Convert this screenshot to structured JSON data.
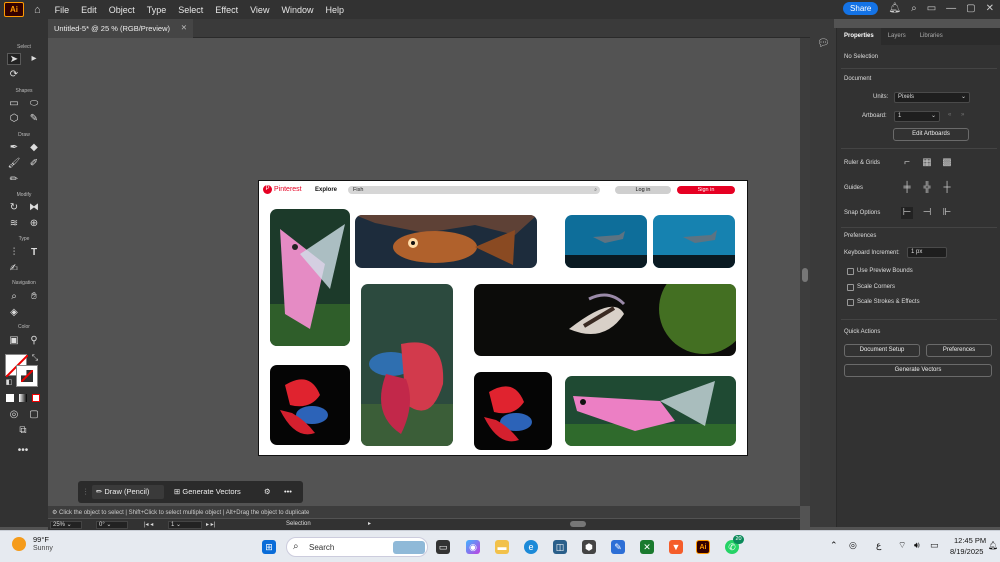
{
  "menubar": {
    "app_logo": "Ai",
    "items": [
      "File",
      "Edit",
      "Object",
      "Type",
      "Select",
      "Effect",
      "View",
      "Window",
      "Help"
    ],
    "share_label": "Share"
  },
  "document_tab": {
    "title": "Untitled-5* @ 25 % (RGB/Preview)"
  },
  "toolbar": {
    "sections": [
      "Select",
      "Shapes",
      "Draw",
      "Modify",
      "Type",
      "Navigation",
      "Color"
    ]
  },
  "artboard": {
    "brand": "Pinterest",
    "explore": "Explore",
    "search_value": "Fish",
    "login": "Log in",
    "signin": "Sign in"
  },
  "properties": {
    "tabs": [
      "Properties",
      "Layers",
      "Libraries"
    ],
    "selection": "No Selection",
    "document_label": "Document",
    "units_label": "Units:",
    "units_value": "Pixels",
    "artboard_label": "Artboard:",
    "artboard_value": "1",
    "edit_artboards": "Edit Artboards",
    "rulers_grids": "Ruler & Grids",
    "guides": "Guides",
    "snap_options": "Snap Options",
    "preferences_label": "Preferences",
    "keyboard_increment_label": "Keyboard Increment:",
    "keyboard_increment_value": "1 px",
    "use_preview_bounds": "Use Preview Bounds",
    "scale_corners": "Scale Corners",
    "scale_strokes": "Scale Strokes & Effects",
    "quick_actions": "Quick Actions",
    "document_setup": "Document Setup",
    "preferences_btn": "Preferences",
    "generate_vectors": "Generate Vectors"
  },
  "floatbar": {
    "draw_pencil": "Draw (Pencil)",
    "generate_vectors": "Generate Vectors"
  },
  "status": {
    "hint": "Click the object to select  |  Shift+Click to select multiple object  |  Alt+Drag the object to duplicate",
    "zoom": "25%",
    "rotation": "0°",
    "artboard": "1",
    "mode": "Selection"
  },
  "taskbar": {
    "temp": "99°F",
    "weather": "Sunny",
    "search": "Search",
    "time": "12:45 PM",
    "date": "8/19/2025",
    "badge": "20"
  }
}
